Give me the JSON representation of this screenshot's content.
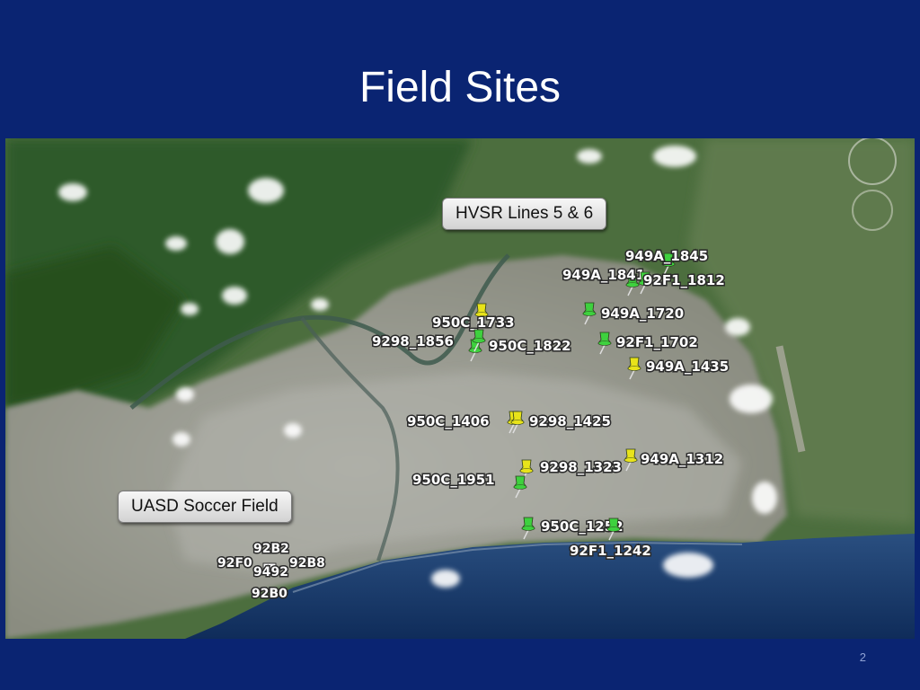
{
  "slide": {
    "title": "Field Sites",
    "page_number": "2"
  },
  "callouts": {
    "hvsr": "HVSR Lines 5 & 6",
    "uasd": "UASD Soccer Field"
  },
  "colors": {
    "slide_background": "#0a2472",
    "pin_green": "#3ed13e",
    "pin_yellow": "#e8e31a",
    "ocean": "#1c3f75",
    "urban": "#9a9b93",
    "vegetation": "#3f6a35"
  },
  "markers": [
    {
      "label": "949A_1845",
      "color": "green"
    },
    {
      "label": "949A_1841",
      "color": "green"
    },
    {
      "label": "92F1_1812",
      "color": "green"
    },
    {
      "label": "949A_1720",
      "color": "green"
    },
    {
      "label": "950C_1733",
      "color": "yellow"
    },
    {
      "label": "9298_1856",
      "color": "green"
    },
    {
      "label": "950C_1822",
      "color": "green"
    },
    {
      "label": "92F1_1702",
      "color": "green"
    },
    {
      "label": "949A_1435",
      "color": "yellow"
    },
    {
      "label": "950C_1406",
      "color": "yellow"
    },
    {
      "label": "9298_1425",
      "color": "yellow"
    },
    {
      "label": "9298_1323",
      "color": "yellow"
    },
    {
      "label": "949A_1312",
      "color": "yellow"
    },
    {
      "label": "950C_1951",
      "color": "green"
    },
    {
      "label": "950C_1252",
      "color": "green"
    },
    {
      "label": "92F1_1242",
      "color": "green"
    }
  ],
  "uasd_sites": {
    "s1": "92B2",
    "s2": "92F0",
    "s3": "92B8",
    "s4": "9492",
    "s5": "92B0"
  }
}
